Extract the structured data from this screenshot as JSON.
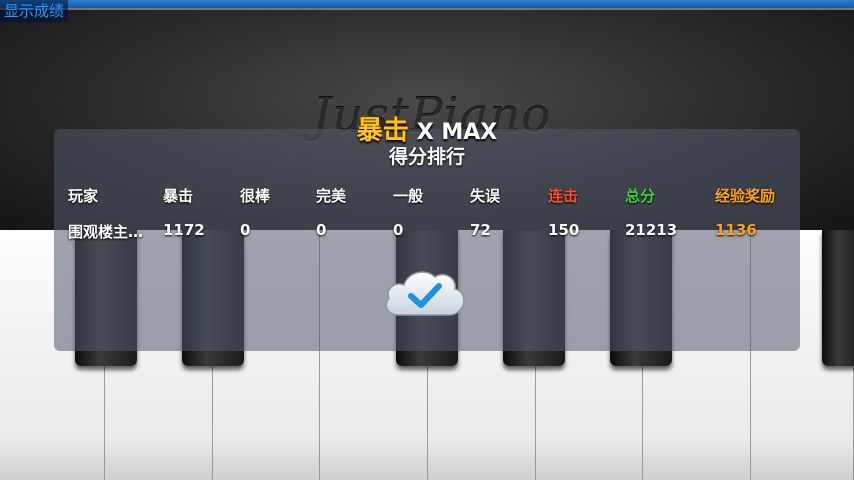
{
  "top_link": "显示成绩",
  "logo_text": "JustPiano",
  "result": {
    "crit_label": "暴击",
    "crit_suffix": "X MAX",
    "subtitle": "得分排行"
  },
  "table": {
    "headers": [
      "玩家",
      "暴击",
      "很棒",
      "完美",
      "一般",
      "失误",
      "连击",
      "总分",
      "经验奖励"
    ],
    "header_colors": [
      "#ffffff",
      "#ffffff",
      "#ffffff",
      "#ffffff",
      "#ffffff",
      "#ffffff",
      "#ff4a2e",
      "#3ed43a",
      "#ffa21a"
    ],
    "rows": [
      [
        "围观楼主…",
        "1172",
        "0",
        "0",
        "0",
        "72",
        "150",
        "21213",
        "1136"
      ]
    ],
    "row_value_colors": [
      "#ffffff",
      "#ffffff",
      "#ffffff",
      "#ffffff",
      "#ffffff",
      "#ffffff",
      "#ffffff",
      "#ffffff",
      "#ffa21a"
    ]
  },
  "confirm_icon": "cloud-check-icon",
  "colors": {
    "accent_link": "#1e9cff",
    "crit_gold": "#ffc21a"
  }
}
